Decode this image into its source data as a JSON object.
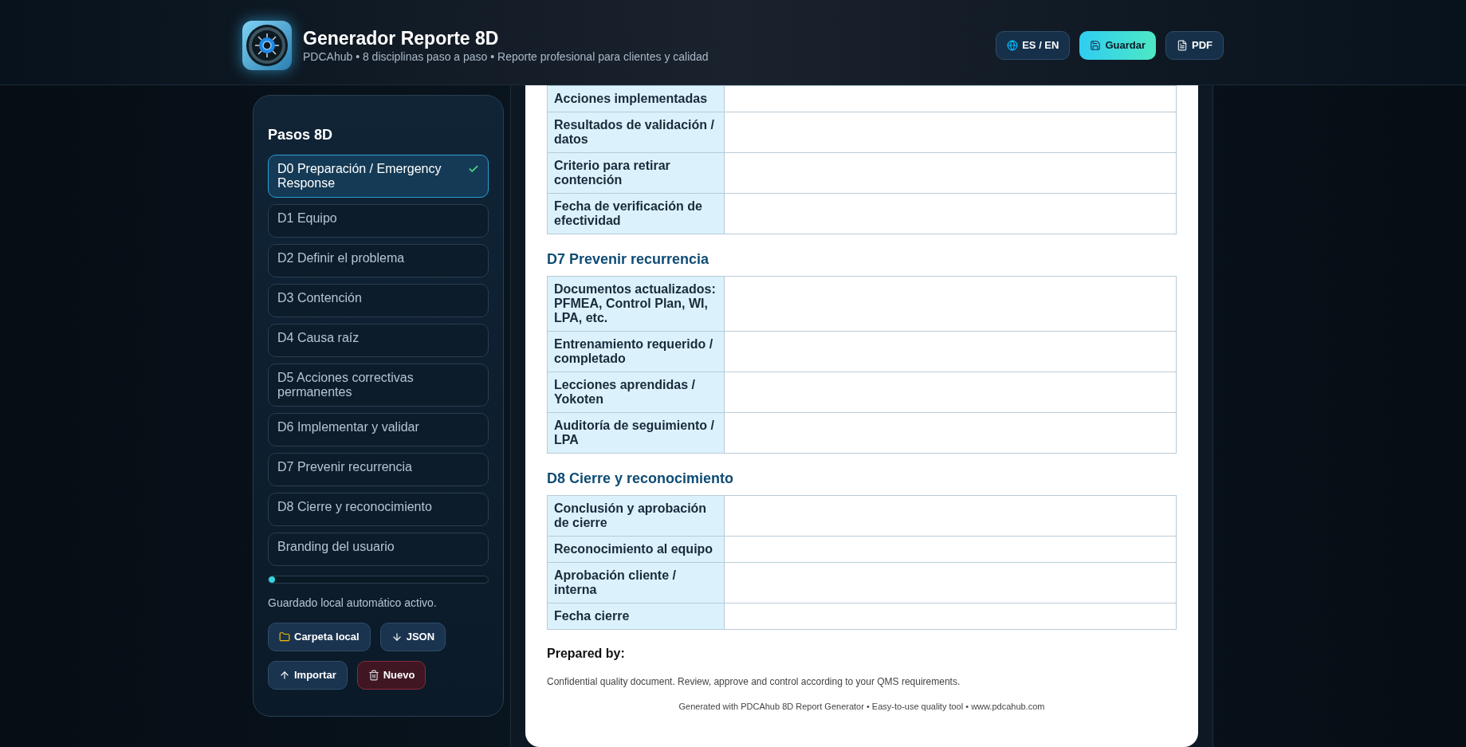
{
  "header": {
    "title": "Generador Reporte 8D",
    "subtitle": "PDCAhub • 8 disciplinas paso a paso • Reporte profesional para clientes y calidad",
    "buttons": [
      {
        "label": "ES / EN",
        "kind": "language"
      },
      {
        "label": "Guardar",
        "kind": "save"
      },
      {
        "label": "PDF",
        "kind": "pdf"
      }
    ]
  },
  "sidebar": {
    "title": "Pasos 8D",
    "steps": [
      {
        "label": "D0 Preparación / Emergency Response",
        "selected": true,
        "checked": true
      },
      {
        "label": "D1 Equipo",
        "selected": false,
        "checked": false
      },
      {
        "label": "D2 Definir el problema",
        "selected": false,
        "checked": false
      },
      {
        "label": "D3 Contención",
        "selected": false,
        "checked": false
      },
      {
        "label": "D4 Causa raíz",
        "selected": false,
        "checked": false
      },
      {
        "label": "D5 Acciones correctivas permanentes",
        "selected": false,
        "checked": false
      },
      {
        "label": "D6 Implementar y validar",
        "selected": false,
        "checked": false
      },
      {
        "label": "D7 Prevenir recurrencia",
        "selected": false,
        "checked": false
      },
      {
        "label": "D8 Cierre y reconocimiento",
        "selected": false,
        "checked": false
      },
      {
        "label": "Branding del usuario",
        "selected": false,
        "checked": false
      }
    ],
    "progress": {
      "level": 0.03
    },
    "status": "Guardado local automático activo.",
    "actions": [
      {
        "label": "Carpeta local",
        "kind": "folder"
      },
      {
        "label": "JSON",
        "kind": "download"
      },
      {
        "label": "Importar",
        "kind": "import"
      },
      {
        "label": "Nuevo",
        "kind": "new"
      }
    ]
  },
  "report": {
    "rows": [
      {
        "label": "Acciones implementadas"
      },
      {
        "label": "Resultados de validación / datos"
      },
      {
        "label": "Criterio para retirar contención"
      },
      {
        "label": "Fecha de verificación de efectividad"
      }
    ],
    "sections": [
      {
        "title": "D7 Prevenir recurrencia",
        "rows": [
          {
            "label": "Documentos actualizados: PFMEA, Control Plan, WI, LPA, etc."
          },
          {
            "label": "Entrenamiento requerido / completado"
          },
          {
            "label": "Lecciones aprendidas / Yokoten"
          },
          {
            "label": "Auditoría de seguimiento / LPA"
          }
        ]
      },
      {
        "title": "D8 Cierre y reconocimiento",
        "rows": [
          {
            "label": "Conclusión y aprobación de cierre"
          },
          {
            "label": "Reconocimiento al equipo"
          },
          {
            "label": "Aprobación cliente / interna"
          },
          {
            "label": "Fecha cierre"
          }
        ]
      }
    ],
    "prepared_by": "Prepared by:",
    "disclaimer": "Confidential quality document. Review, approve and control according to your QMS requirements.",
    "footer": "Generated with PDCAhub 8D Report Generator • Easy-to-use quality tool • www.pdcahub.com"
  }
}
